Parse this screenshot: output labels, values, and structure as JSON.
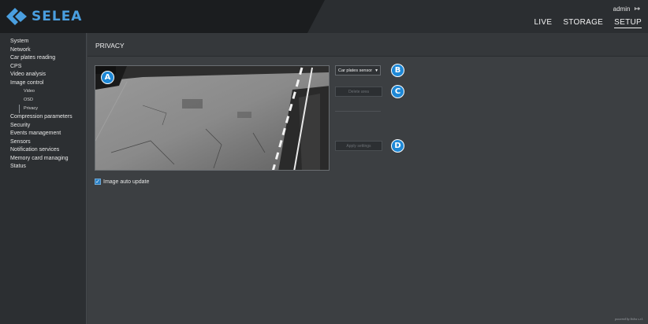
{
  "header": {
    "brand": "SELEA",
    "user": "admin",
    "logout_icon": "logout-icon",
    "nav": [
      {
        "label": "LIVE"
      },
      {
        "label": "STORAGE"
      },
      {
        "label": "SETUP",
        "active": true
      }
    ]
  },
  "sidebar": {
    "items": [
      {
        "label": "System"
      },
      {
        "label": "Network"
      },
      {
        "label": "Car plates reading"
      },
      {
        "label": "CPS"
      },
      {
        "label": "Video analysis"
      },
      {
        "label": "Image control"
      },
      {
        "label": "Video",
        "sub": true
      },
      {
        "label": "OSD",
        "sub": true
      },
      {
        "label": "Privacy",
        "sub": true,
        "active": true
      },
      {
        "label": "Compression parameters"
      },
      {
        "label": "Security"
      },
      {
        "label": "Events management"
      },
      {
        "label": "Sensors"
      },
      {
        "label": "Notification services"
      },
      {
        "label": "Memory card managing"
      },
      {
        "label": "Status"
      }
    ]
  },
  "main": {
    "title": "PRIVACY",
    "sensor_select": "Car plates sensor",
    "delete_area": "Delete area",
    "apply_settings": "Apply settings",
    "auto_update_label": "Image auto update",
    "auto_update_checked": true,
    "badges": {
      "a": "A",
      "b": "B",
      "c": "C",
      "d": "D"
    }
  },
  "footer": {
    "powered_by": "powered by Selea s.r.l."
  },
  "colors": {
    "brand_blue": "#4a9fe0",
    "badge_blue": "#1e88d6",
    "background": "#3c3f42",
    "header": "#1b1d1f"
  }
}
